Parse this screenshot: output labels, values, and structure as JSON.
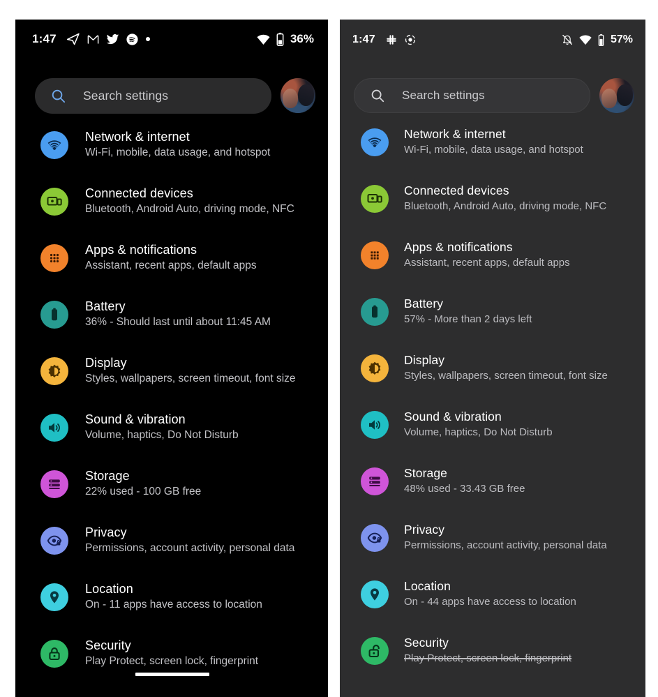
{
  "panels": [
    {
      "id": "left",
      "status": {
        "time": "1:47",
        "left_icons": [
          "telegram-icon",
          "gmail-icon",
          "twitter-icon",
          "spotify-icon",
          "dot-icon"
        ],
        "right_icons": [
          "wifi-icon",
          "battery-icon"
        ],
        "battery_percent": "36%"
      },
      "search": {
        "placeholder": "Search settings",
        "icon": "search-icon",
        "avatar": "user-avatar"
      },
      "items": [
        {
          "icon": "wifi-icon",
          "icon_color": "#4a9df0",
          "title": "Network & internet",
          "subtitle": "Wi-Fi, mobile, data usage, and hotspot"
        },
        {
          "icon": "connected-devices-icon",
          "icon_color": "#8bc936",
          "title": "Connected devices",
          "subtitle": "Bluetooth, Android Auto, driving mode, NFC"
        },
        {
          "icon": "apps-grid-icon",
          "icon_color": "#f1822c",
          "title": "Apps & notifications",
          "subtitle": "Assistant, recent apps, default apps"
        },
        {
          "icon": "battery-icon",
          "icon_color": "#2b9e93",
          "title": "Battery",
          "subtitle": "36% - Should last until about 11:45 AM"
        },
        {
          "icon": "brightness-icon",
          "icon_color": "#f4b councils"
        }
      ]
    }
  ]
}
